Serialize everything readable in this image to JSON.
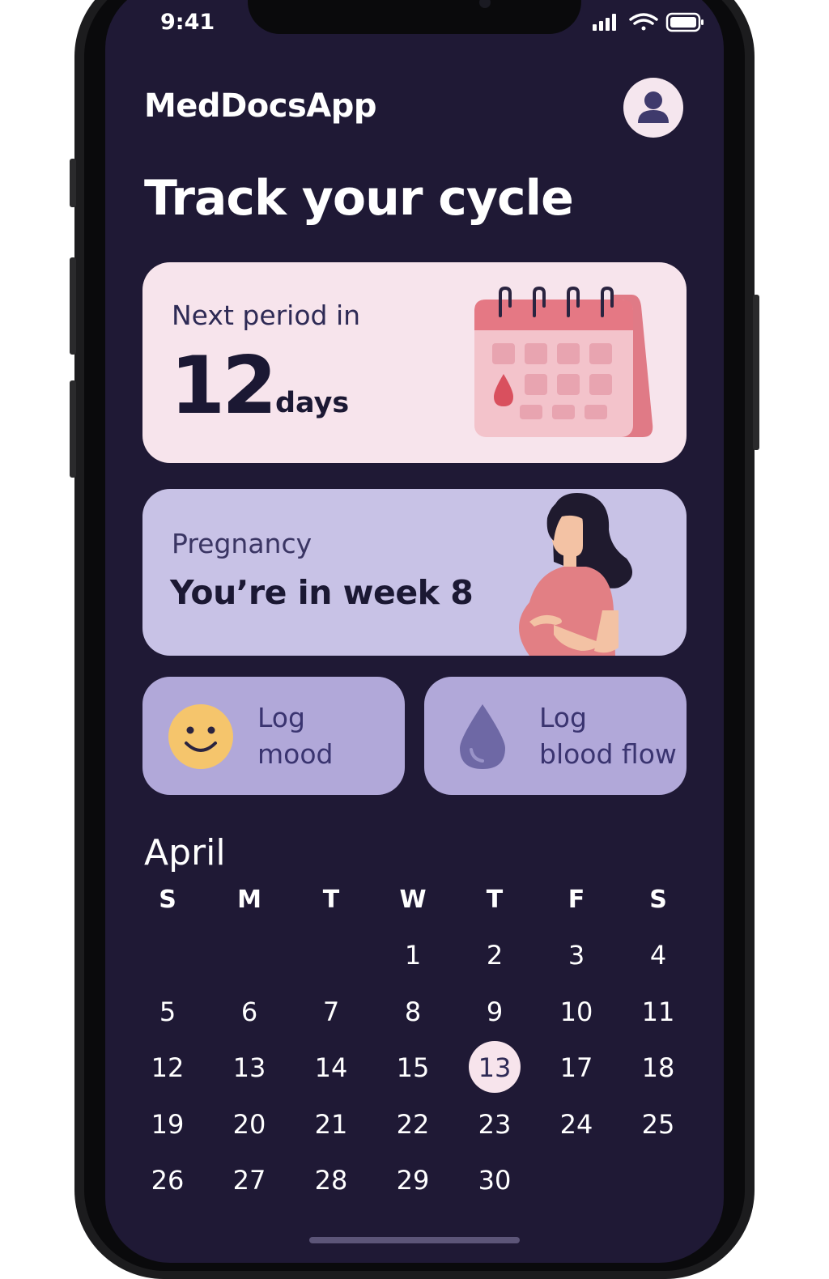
{
  "status_bar": {
    "time": "9:41"
  },
  "header": {
    "app_title": "MedDocsApp",
    "avatar_icon": "user-icon"
  },
  "headline": "Track your cycle",
  "period_card": {
    "label": "Next period in",
    "days_value": "12",
    "days_unit": "days",
    "icon": "calendar-drop-icon"
  },
  "pregnancy_card": {
    "label": "Pregnancy",
    "status": "You’re in week 8",
    "illustration": "pregnant-woman-illustration"
  },
  "quick_actions": [
    {
      "line1": "Log",
      "line2": "mood",
      "icon": "smiley-icon"
    },
    {
      "line1": "Log",
      "line2": "blood flow",
      "icon": "drop-icon"
    }
  ],
  "calendar": {
    "month": "April",
    "weekdays": [
      "S",
      "M",
      "T",
      "W",
      "T",
      "F",
      "S"
    ],
    "weeks": [
      [
        "",
        "",
        "",
        "1",
        "2",
        "3",
        "4"
      ],
      [
        "5",
        "6",
        "7",
        "8",
        "9",
        "10",
        "11"
      ],
      [
        "12",
        "13",
        "14",
        "15",
        "13",
        "17",
        "18"
      ],
      [
        "19",
        "20",
        "21",
        "22",
        "23",
        "24",
        "25"
      ],
      [
        "26",
        "27",
        "28",
        "29",
        "30",
        "",
        ""
      ]
    ],
    "selected": {
      "week": 2,
      "day": 4
    }
  },
  "colors": {
    "background": "#1f1935",
    "period_card": "#f7e4ec",
    "pregnancy_card": "#c8c2e6",
    "action_card": "#b1a8d9",
    "accent_pink": "#e06b78",
    "drop_purple": "#6e68a5",
    "smiley_yellow": "#f5c56c"
  }
}
